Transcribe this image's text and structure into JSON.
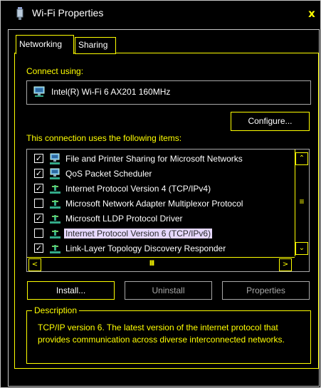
{
  "window": {
    "title": "Wi-Fi Properties",
    "close_glyph": "x",
    "title_icon": "wifi-adapter-icon"
  },
  "tabs": [
    {
      "label": "Networking",
      "active": true
    },
    {
      "label": "Sharing",
      "active": false
    }
  ],
  "connect_using": {
    "label": "Connect using:",
    "adapter": "Intel(R) Wi-Fi 6 AX201 160MHz",
    "adapter_icon": "network-adapter-icon"
  },
  "configure_button": "Configure...",
  "items_label": "This connection uses the following items:",
  "items": [
    {
      "label": "File and Printer Sharing for Microsoft Networks",
      "checked": true,
      "icon": "network-client-icon",
      "selected": false
    },
    {
      "label": "QoS Packet Scheduler",
      "checked": true,
      "icon": "network-client-icon",
      "selected": false
    },
    {
      "label": "Internet Protocol Version 4 (TCP/IPv4)",
      "checked": true,
      "icon": "protocol-icon",
      "selected": false
    },
    {
      "label": "Microsoft Network Adapter Multiplexor Protocol",
      "checked": false,
      "icon": "protocol-icon",
      "selected": false
    },
    {
      "label": "Microsoft LLDP Protocol Driver",
      "checked": true,
      "icon": "protocol-icon",
      "selected": false
    },
    {
      "label": "Internet Protocol Version 6 (TCP/IPv6)",
      "checked": false,
      "icon": "protocol-icon",
      "selected": true
    },
    {
      "label": "Link-Layer Topology Discovery Responder",
      "checked": true,
      "icon": "protocol-icon",
      "selected": false
    }
  ],
  "checkmark_glyph": "✓",
  "scroll": {
    "up": "⌃",
    "down": "⌄",
    "left": "<",
    "right": ">",
    "v_thumb": "≡",
    "h_thumb": "III"
  },
  "buttons": {
    "install": "Install...",
    "uninstall": "Uninstall",
    "properties": "Properties"
  },
  "description": {
    "title": "Description",
    "text": "TCP/IP version 6. The latest version of the internet protocol that provides communication across diverse interconnected networks."
  },
  "colors": {
    "accent": "#ffff00",
    "selection": "#e6d8ff",
    "disabled": "#a8a8a8",
    "background": "#000000"
  }
}
